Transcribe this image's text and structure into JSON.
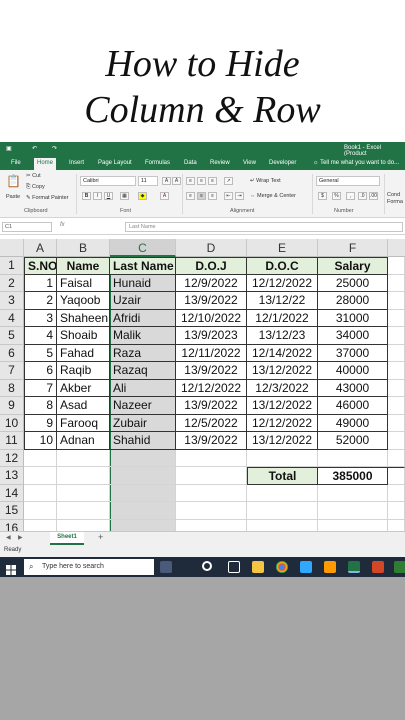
{
  "title": {
    "line1": "How to Hide",
    "line2": "Column & Row"
  },
  "window": {
    "title": "Book1 - Excel (Product"
  },
  "tabs": [
    "File",
    "Home",
    "Insert",
    "Page Layout",
    "Formulas",
    "Data",
    "Review",
    "View",
    "Developer"
  ],
  "tell_me": "Tell me what you want to do...",
  "ribbon": {
    "paste": "Paste",
    "cut": "Cut",
    "copy": "Copy",
    "format_painter": "Format Painter",
    "clipboard": "Clipboard",
    "font_name": "Calibri",
    "font_size": "11",
    "font": "Font",
    "wrap_text": "Wrap Text",
    "merge_center": "Merge & Center",
    "alignment": "Alignment",
    "number_format": "General",
    "number": "Number",
    "cond_format": "Cond Forma",
    "bold": "B",
    "italic": "I",
    "underline": "U",
    "currency": "$",
    "percent": "%"
  },
  "formula_bar": {
    "name_box": "C1",
    "fx": "fx",
    "value": "Last Name"
  },
  "columns": [
    "A",
    "B",
    "C",
    "D",
    "E",
    "F"
  ],
  "table": {
    "headers": [
      "S.NO",
      "Name",
      "Last Name",
      "D.O.J",
      "D.O.C",
      "Salary"
    ],
    "rows": [
      [
        "1",
        "Faisal",
        "Hunaid",
        "12/9/2022",
        "12/12/2022",
        "25000"
      ],
      [
        "2",
        "Yaqoob",
        "Uzair",
        "13/9/2022",
        "13/12/22",
        "28000"
      ],
      [
        "3",
        "Shaheen",
        "Afridi",
        "12/10/2022",
        "12/1/2022",
        "31000"
      ],
      [
        "4",
        "Shoaib",
        "Malik",
        "13/9/2023",
        "13/12/23",
        "34000"
      ],
      [
        "5",
        "Fahad",
        "Raza",
        "12/11/2022",
        "12/14/2022",
        "37000"
      ],
      [
        "6",
        "Raqib",
        "Razaq",
        "13/9/2022",
        "13/12/2022",
        "40000"
      ],
      [
        "7",
        "Akber",
        "Ali",
        "12/12/2022",
        "12/3/2022",
        "43000"
      ],
      [
        "8",
        "Asad",
        "Nazeer",
        "13/9/2022",
        "13/12/2022",
        "46000"
      ],
      [
        "9",
        "Farooq",
        "Zubair",
        "12/5/2022",
        "12/12/2022",
        "49000"
      ],
      [
        "10",
        "Adnan",
        "Shahid",
        "13/9/2022",
        "13/12/2022",
        "52000"
      ]
    ],
    "total_label": "Total",
    "total_value": "385000"
  },
  "row_numbers": [
    "1",
    "2",
    "3",
    "4",
    "5",
    "6",
    "7",
    "8",
    "9",
    "10",
    "11",
    "12",
    "13",
    "14",
    "15",
    "16"
  ],
  "sheet_tab": "Sheet1",
  "add_sheet": "+",
  "status": "Ready",
  "taskbar": {
    "search_placeholder": "Type here to search"
  },
  "colors": {
    "excel_green": "#217346",
    "header_fill": "#e2efda",
    "selected_col": "#d9d9d9"
  }
}
